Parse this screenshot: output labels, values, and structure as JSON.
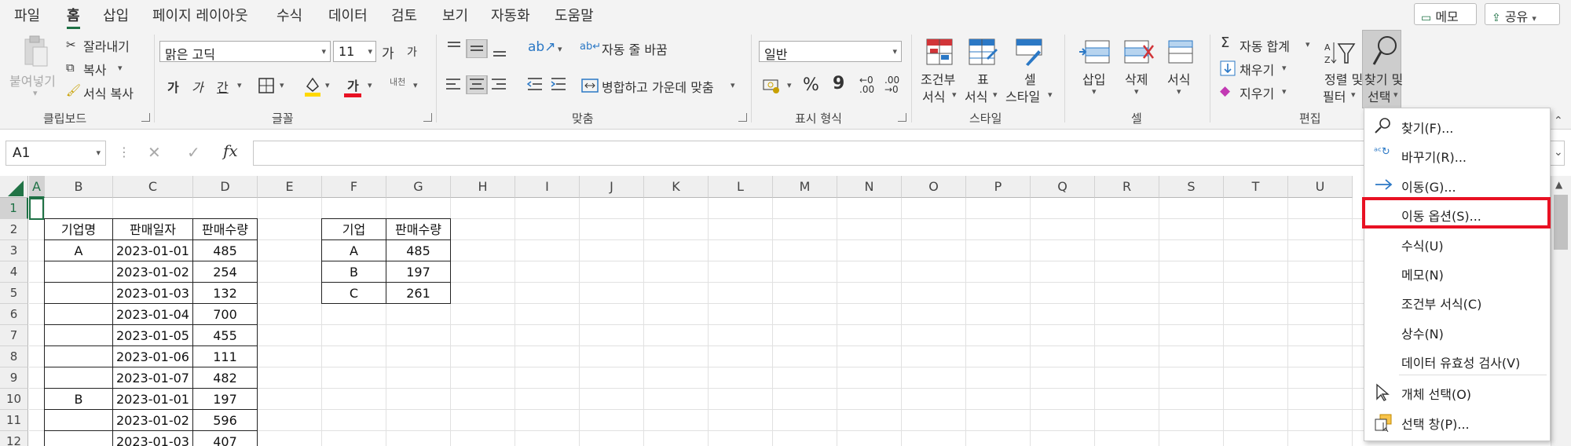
{
  "tabs": [
    "파일",
    "홈",
    "삽입",
    "페이지 레이아웃",
    "수식",
    "데이터",
    "검토",
    "보기",
    "자동화",
    "도움말"
  ],
  "active_tab": "홈",
  "top_buttons": {
    "comment": "메모",
    "share": "공유"
  },
  "clipboard": {
    "paste": "붙여넣기",
    "cut": "잘라내기",
    "copy": "복사",
    "format_painter": "서식 복사",
    "label": "클립보드"
  },
  "font": {
    "name": "맑은 고딕",
    "size": "11",
    "grow": "가",
    "shrink": "가",
    "bold": "가",
    "italic": "가",
    "underline": "간",
    "font_color": "가",
    "phonetic": "내천",
    "label": "글꼴"
  },
  "alignment": {
    "wrap": "자동 줄 바꿈",
    "merge": "병합하고 가운데 맞춤",
    "label": "맞춤"
  },
  "number": {
    "format": "일반",
    "percent": "%",
    "comma": "9",
    "label": "표시 형식"
  },
  "styles": {
    "conditional": [
      "조건부",
      "서식"
    ],
    "table": [
      "표",
      "서식"
    ],
    "cell": [
      "셀",
      "스타일"
    ],
    "label": "스타일"
  },
  "cells": {
    "insert": "삽입",
    "delete": "삭제",
    "format": "서식",
    "label": "셀"
  },
  "editing": {
    "autosum": "자동 합계",
    "fill": "채우기",
    "clear": "지우기",
    "sort": [
      "정렬 및",
      "필터"
    ],
    "find": [
      "찾기 및",
      "선택"
    ],
    "label": "편집"
  },
  "formula_bar": {
    "name_box": "A1",
    "fx": "fx"
  },
  "columns": [
    "A",
    "B",
    "C",
    "D",
    "E",
    "F",
    "G",
    "H",
    "I",
    "J",
    "K",
    "L",
    "M",
    "N",
    "O",
    "P",
    "Q",
    "R",
    "S",
    "T",
    "U"
  ],
  "rows": [
    "1",
    "2",
    "3",
    "4",
    "5",
    "6",
    "7",
    "8",
    "9",
    "10",
    "11",
    "12"
  ],
  "table1": {
    "headers": [
      "기업명",
      "판매일자",
      "판매수량"
    ],
    "rows": [
      [
        "A",
        "2023-01-01",
        "485"
      ],
      [
        "",
        "2023-01-02",
        "254"
      ],
      [
        "",
        "2023-01-03",
        "132"
      ],
      [
        "",
        "2023-01-04",
        "700"
      ],
      [
        "",
        "2023-01-05",
        "455"
      ],
      [
        "",
        "2023-01-06",
        "111"
      ],
      [
        "",
        "2023-01-07",
        "482"
      ],
      [
        "B",
        "2023-01-01",
        "197"
      ],
      [
        "",
        "2023-01-02",
        "596"
      ],
      [
        "",
        "2023-01-03",
        "407"
      ]
    ]
  },
  "table2": {
    "headers": [
      "기업",
      "판매수량"
    ],
    "rows": [
      [
        "A",
        "485"
      ],
      [
        "B",
        "197"
      ],
      [
        "C",
        "261"
      ]
    ]
  },
  "menu": {
    "items": [
      "찾기(F)...",
      "바꾸기(R)...",
      "이동(G)...",
      "이동 옵션(S)...",
      "수식(U)",
      "메모(N)",
      "조건부 서식(C)",
      "상수(N)",
      "데이터 유효성 검사(V)",
      "개체 선택(O)",
      "선택 창(P)..."
    ],
    "highlight_color": "#e81123"
  },
  "colors": {
    "accent": "#1e7145",
    "highlight": "#e81123",
    "menu_icon_blue": "#2b78c5"
  }
}
